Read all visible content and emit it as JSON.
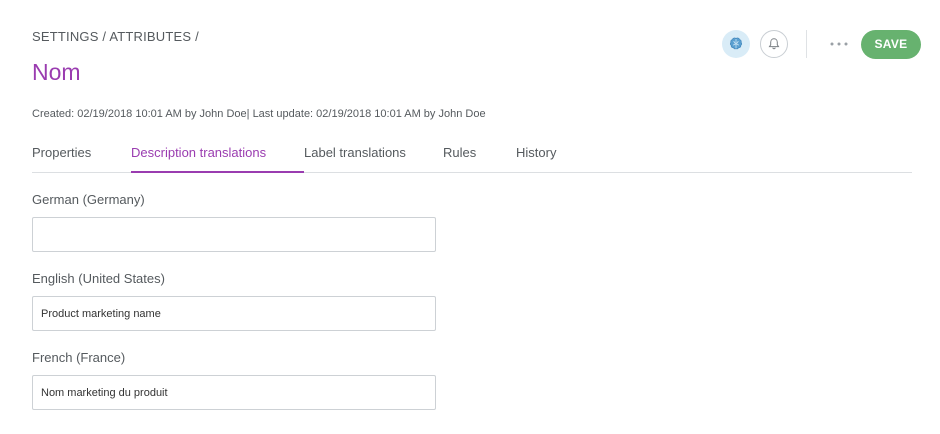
{
  "breadcrumb": "SETTINGS / ATTRIBUTES /",
  "title": "Nom",
  "meta": "Created: 02/19/2018 10:01 AM by John Doe| Last update: 02/19/2018 10:01 AM by John Doe",
  "header_actions": {
    "avatar_icon": "brain-icon",
    "notification_icon": "bell-icon",
    "more_icon": "more-horizontal-icon",
    "save_label": "SAVE",
    "save_color": "#67b26f"
  },
  "tabs": [
    {
      "label": "Properties",
      "active": false
    },
    {
      "label": "Description translations",
      "active": true
    },
    {
      "label": "Label translations",
      "active": false
    },
    {
      "label": "Rules",
      "active": false
    },
    {
      "label": "History",
      "active": false
    }
  ],
  "fields": [
    {
      "label": "German (Germany)",
      "value": "",
      "placeholder": ""
    },
    {
      "label": "English (United States)",
      "value": "Product marketing name"
    },
    {
      "label": "French (France)",
      "value": "Nom marketing du produit"
    }
  ],
  "colors": {
    "accent": "#9a3cb0",
    "text": "#555a5e",
    "border": "#cdd1d5"
  }
}
